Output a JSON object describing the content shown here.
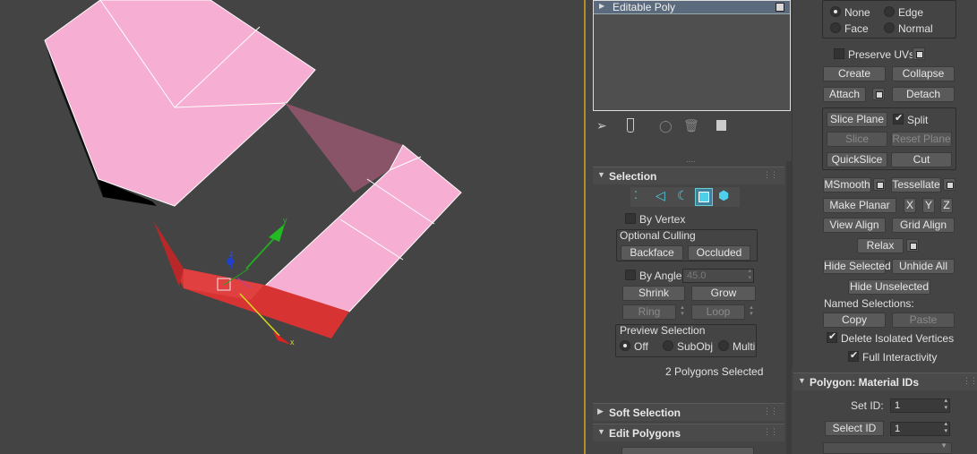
{
  "modifier_stack": {
    "item_label": "Editable Poly"
  },
  "selection": {
    "title": "Selection",
    "by_vertex": "By Vertex",
    "optional_culling": "Optional Culling",
    "backface": "Backface",
    "occluded": "Occluded",
    "by_angle": "By Angle:",
    "by_angle_value": "45.0",
    "shrink": "Shrink",
    "grow": "Grow",
    "ring": "Ring",
    "loop": "Loop",
    "preview_selection": "Preview Selection",
    "off": "Off",
    "subobj": "SubObj",
    "multi": "Multi",
    "status": "2 Polygons Selected"
  },
  "soft_selection": {
    "title": "Soft Selection"
  },
  "edit_polygons": {
    "title": "Edit Polygons"
  },
  "edit_geometry": {
    "none": "None",
    "edge": "Edge",
    "face": "Face",
    "normal": "Normal",
    "preserve_uvs": "Preserve UVs",
    "create": "Create",
    "collapse": "Collapse",
    "attach": "Attach",
    "detach": "Detach",
    "slice_plane": "Slice Plane",
    "split": "Split",
    "slice": "Slice",
    "reset_plane": "Reset Plane",
    "quickslice": "QuickSlice",
    "cut": "Cut",
    "msmooth": "MSmooth",
    "tessellate": "Tessellate",
    "make_planar": "Make Planar",
    "x": "X",
    "y": "Y",
    "z": "Z",
    "view_align": "View Align",
    "grid_align": "Grid Align",
    "relax": "Relax",
    "hide_selected": "Hide Selected",
    "unhide_all": "Unhide All",
    "hide_unselected": "Hide Unselected",
    "named_selections": "Named Selections:",
    "copy": "Copy",
    "paste": "Paste",
    "delete_isolated": "Delete Isolated Vertices",
    "full_interactivity": "Full Interactivity"
  },
  "material_ids": {
    "title": "Polygon: Material IDs",
    "set_id": "Set ID:",
    "set_id_value": "1",
    "select_id": "Select ID",
    "select_id_value": "1"
  },
  "gizmo": {
    "x": "x",
    "y": "y",
    "z": "z"
  },
  "colors": {
    "viewport_bg": "#444444",
    "poly_pink": "#f6aed2",
    "poly_selected": "#d83333",
    "active_border": "#b08d2f"
  }
}
